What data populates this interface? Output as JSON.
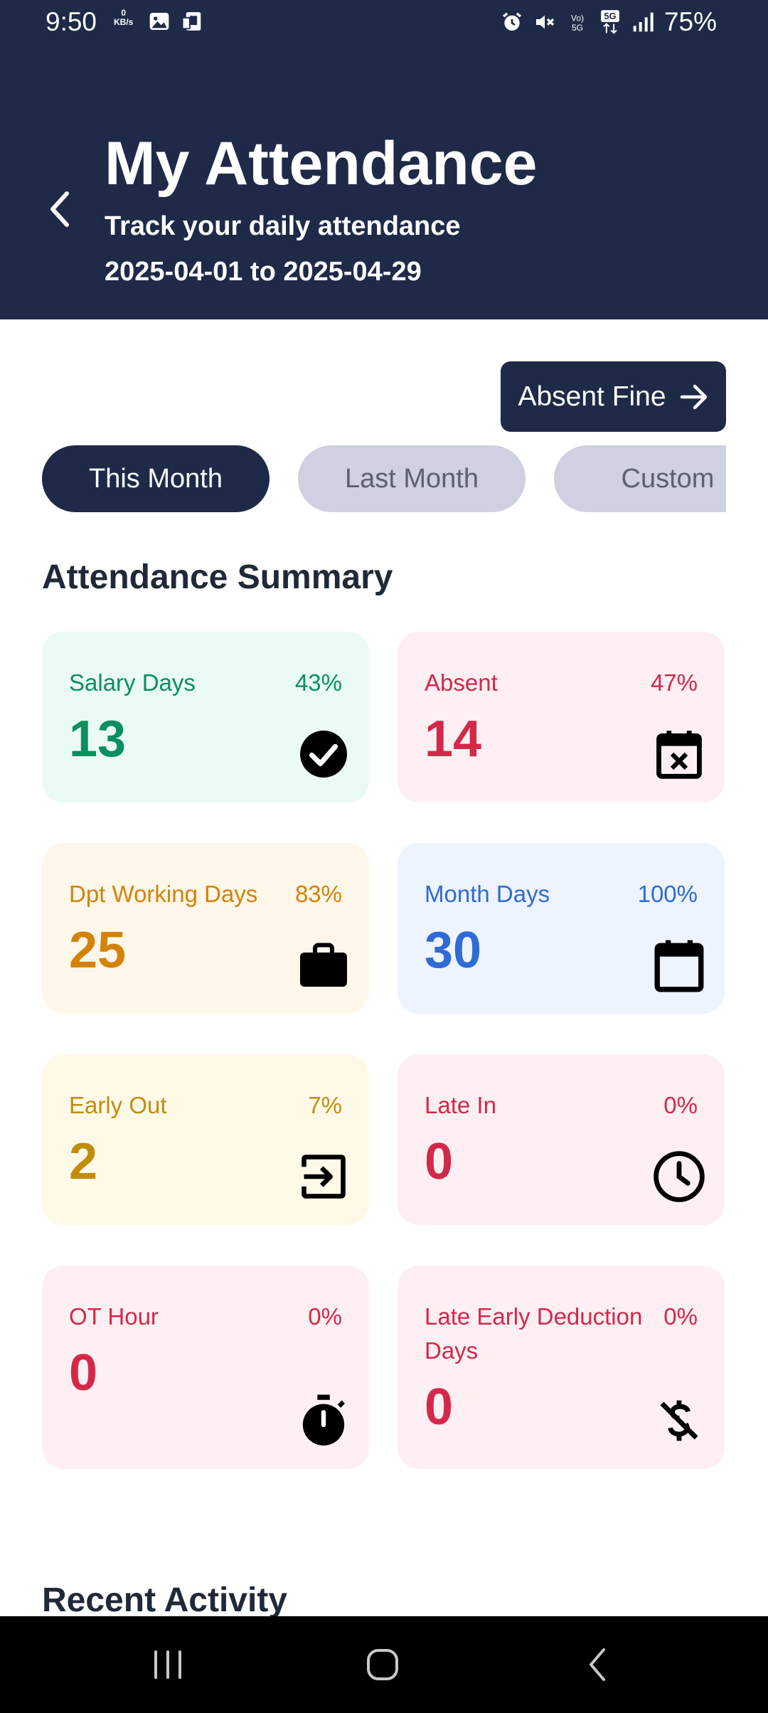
{
  "status_bar": {
    "time": "9:50",
    "speed_value": "0",
    "speed_unit": "KB/s",
    "battery": "75%"
  },
  "header": {
    "title": "My Attendance",
    "subtitle": "Track your daily attendance",
    "date_range": "2025-04-01 to 2025-04-29"
  },
  "absent_fine": {
    "label": "Absent Fine"
  },
  "tabs": [
    {
      "label": "This Month",
      "active": true
    },
    {
      "label": "Last Month",
      "active": false
    },
    {
      "label": "Custom",
      "active": false
    }
  ],
  "summary": {
    "title": "Attendance Summary",
    "cards": [
      {
        "label": "Salary Days",
        "percent": "43%",
        "value": "13",
        "icon": "check-circle-icon",
        "color": "#0c8f5d"
      },
      {
        "label": "Absent",
        "percent": "47%",
        "value": "14",
        "icon": "calendar-x-icon",
        "color": "#d4284a"
      },
      {
        "label": "Dpt Working Days",
        "percent": "83%",
        "value": "25",
        "icon": "briefcase-icon",
        "color": "#d4820a"
      },
      {
        "label": "Month Days",
        "percent": "100%",
        "value": "30",
        "icon": "calendar-icon",
        "color": "#2f6ad6"
      },
      {
        "label": "Early Out",
        "percent": "7%",
        "value": "2",
        "icon": "exit-icon",
        "color": "#c28c0d"
      },
      {
        "label": "Late In",
        "percent": "0%",
        "value": "0",
        "icon": "clock-icon",
        "color": "#d4284a"
      },
      {
        "label": "OT Hour",
        "percent": "0%",
        "value": "0",
        "icon": "stopwatch-icon",
        "color": "#d4284a"
      },
      {
        "label": "Late Early Deduction Days",
        "percent": "0%",
        "value": "0",
        "icon": "money-off-icon",
        "color": "#d4284a"
      }
    ]
  },
  "recent": {
    "title": "Recent Activity"
  },
  "colors": {
    "header_bg": "#1e2a47",
    "tab_inactive_bg": "#cfd1e2"
  }
}
